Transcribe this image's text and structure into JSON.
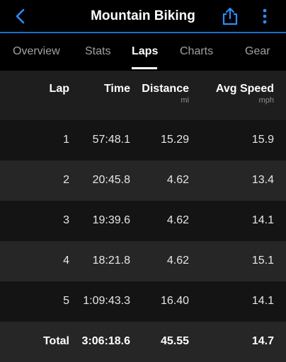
{
  "header": {
    "title": "Mountain Biking",
    "accent": "#1d6fcc"
  },
  "tabs": [
    {
      "label": "Overview",
      "active": false
    },
    {
      "label": "Stats",
      "active": false
    },
    {
      "label": "Laps",
      "active": true
    },
    {
      "label": "Charts",
      "active": false
    },
    {
      "label": "Gear",
      "active": false
    }
  ],
  "table": {
    "columns": [
      {
        "label": "Lap",
        "unit": ""
      },
      {
        "label": "Time",
        "unit": ""
      },
      {
        "label": "Distance",
        "unit": "mi"
      },
      {
        "label": "Avg Speed",
        "unit": "mph"
      }
    ],
    "rows": [
      {
        "lap": "1",
        "time": "57:48.1",
        "distance": "15.29",
        "speed": "15.9"
      },
      {
        "lap": "2",
        "time": "20:45.8",
        "distance": "4.62",
        "speed": "13.4"
      },
      {
        "lap": "3",
        "time": "19:39.6",
        "distance": "4.62",
        "speed": "14.1"
      },
      {
        "lap": "4",
        "time": "18:21.8",
        "distance": "4.62",
        "speed": "15.1"
      },
      {
        "lap": "5",
        "time": "1:09:43.3",
        "distance": "16.40",
        "speed": "14.1"
      }
    ],
    "total": {
      "lap": "Total",
      "time": "3:06:18.6",
      "distance": "45.55",
      "speed": "14.7"
    }
  }
}
